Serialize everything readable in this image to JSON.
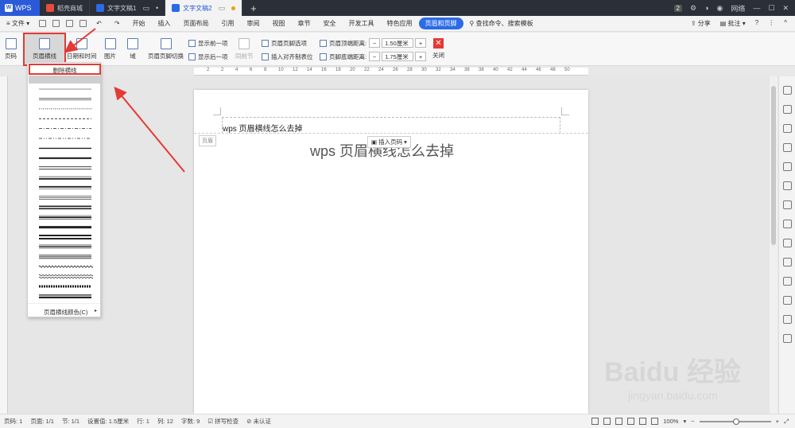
{
  "titlebar": {
    "app_label": "WPS",
    "tabs": [
      {
        "label": "稻壳商城",
        "active": false
      },
      {
        "label": "文字文稿1",
        "active": false
      },
      {
        "label": "文字文稿2",
        "active": true
      }
    ],
    "add_tab": "+",
    "page_count": "2",
    "account": "网络"
  },
  "menubar": {
    "file": "文件",
    "items": [
      "开始",
      "插入",
      "页面布局",
      "引用",
      "审阅",
      "视图",
      "章节",
      "安全",
      "开发工具",
      "特色应用",
      "页眉和页脚"
    ],
    "active_item": "页眉和页脚",
    "search": "查找命令、搜索模板",
    "share": "分享",
    "comment": "批注",
    "help": "?"
  },
  "ribbon": {
    "page_number": "页码",
    "header_line": "页眉横线",
    "date_time": "日期和时间",
    "picture": "图片",
    "field": "域",
    "switch": "页眉页脚切换",
    "show_prev": "显示前一项",
    "show_next": "显示后一项",
    "same_as_prev": "同前节",
    "hf_options": "页眉页脚选项",
    "insert_align_tab": "插入对齐制表位",
    "header_top_label": "页眉顶端距离:",
    "header_top_value": "1.50厘米",
    "footer_bottom_label": "页脚底端距离:",
    "footer_bottom_value": "1.75厘米",
    "close": "关闭"
  },
  "ruler": {
    "numbers": [
      "2",
      "2",
      "4",
      "6",
      "8",
      "10",
      "12",
      "14",
      "16",
      "18",
      "20",
      "22",
      "24",
      "26",
      "28",
      "30",
      "32",
      "34",
      "36",
      "38",
      "40",
      "42",
      "44",
      "46",
      "48",
      "50"
    ]
  },
  "dropdown": {
    "delete_line": "删除横线",
    "line_color": "页眉横线颜色(C)",
    "line_styles": [
      "thin",
      "thin-double",
      "dotted",
      "dashed",
      "dash-dot",
      "dash-dot-dot",
      "medium",
      "thick",
      "double",
      "thin-thick",
      "thick-thin",
      "triple",
      "thick-double",
      "thin-thick-thin",
      "heavy",
      "double-heavy",
      "thin-double-thin",
      "triple-thin",
      "wavy",
      "double-wavy",
      "hatched",
      "heavy-2"
    ]
  },
  "document": {
    "header_text": "wps 页眉横线怎么去掉",
    "header_label": "页眉",
    "insert_page_number": "插入页码",
    "body_title": "wps 页眉横线怎么去掉"
  },
  "statusbar": {
    "page": "页码: 1",
    "pages": "页面: 1/1",
    "section": "节: 1/1",
    "setting": "设置值: 1.5厘米",
    "row": "行: 1",
    "col": "列: 12",
    "words": "字数: 9",
    "spell": "拼写检查",
    "cert": "未认证",
    "zoom": "100%",
    "zoom_level": 0.5
  },
  "watermark": {
    "brand": "Baidu 经验",
    "url": "jingyan.baidu.com"
  },
  "colors": {
    "accent": "#2b6be6",
    "highlight": "#e53935",
    "titlebar": "#2b2f38"
  }
}
